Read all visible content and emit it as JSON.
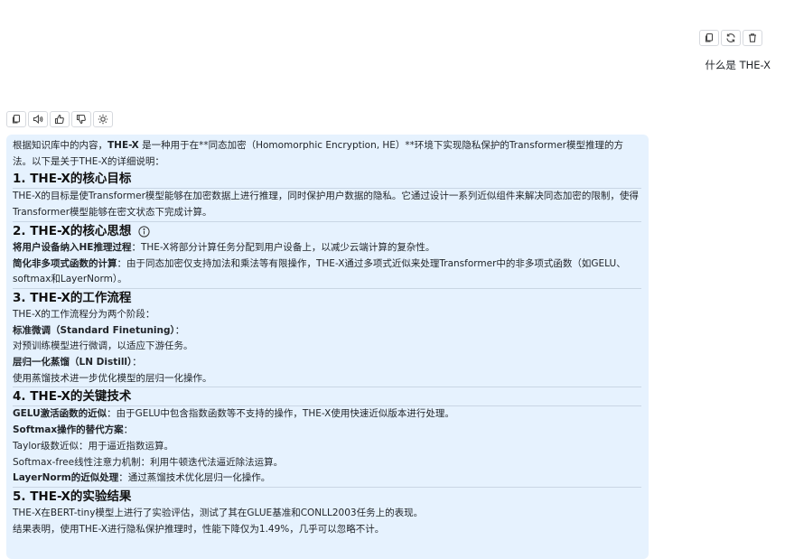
{
  "user_message": "什么是 THE-X",
  "user_toolbar": {
    "icons": [
      "copy-icon",
      "refresh-icon",
      "trash-icon"
    ]
  },
  "ai_toolbar": {
    "icons": [
      "copy-icon",
      "speaker-icon",
      "thumbs-up-icon",
      "thumbs-down-icon",
      "sun-icon"
    ]
  },
  "answer": {
    "intro_1": "根据知识库中的内容，",
    "intro_bold": "THE-X",
    "intro_2": " 是一种用于在**同态加密（Homomorphic Encryption, HE）**环境下实现隐私保护的Transformer模型推理的方法。以下是关于THE-X的详细说明：",
    "s1_title": "1. THE-X的核心目标",
    "s1_text": "THE-X的目标是使Transformer模型能够在加密数据上进行推理，同时保护用户数据的隐私。它通过设计一系列近似组件来解决同态加密的限制，使得Transformer模型能够在密文状态下完成计算。",
    "s2_title": "2. THE-X的核心思想",
    "s2_item1_bold": "将用户设备纳入HE推理过程",
    "s2_item1_text": "：THE-X将部分计算任务分配到用户设备上，以减少云端计算的复杂性。",
    "s2_item2_bold": "简化非多项式函数的计算",
    "s2_item2_text": "：由于同态加密仅支持加法和乘法等有限操作，THE-X通过多项式近似来处理Transformer中的非多项式函数（如GELU、softmax和LayerNorm）。",
    "s3_title": "3. THE-X的工作流程",
    "s3_intro": "THE-X的工作流程分为两个阶段：",
    "s3_stage1_bold": "标准微调（Standard Finetuning）",
    "s3_stage1_colon": "：",
    "s3_stage1_text": "对预训练模型进行微调，以适应下游任务。",
    "s3_stage2_bold": "层归一化蒸馏（LN Distill）",
    "s3_stage2_colon": "：",
    "s3_stage2_text": "使用蒸馏技术进一步优化模型的层归一化操作。",
    "s4_title": "4. THE-X的关键技术",
    "s4_item1_bold": "GELU激活函数的近似",
    "s4_item1_text": "：由于GELU中包含指数函数等不支持的操作，THE-X使用快速近似版本进行处理。",
    "s4_item2_bold": "Softmax操作的替代方案",
    "s4_item2_colon": "：",
    "s4_item2_sub1": "Taylor级数近似：用于逼近指数运算。",
    "s4_item2_sub2": "Softmax-free线性注意力机制：利用牛顿迭代法逼近除法运算。",
    "s4_item3_bold": "LayerNorm的近似处理",
    "s4_item3_text": "：通过蒸馏技术优化层归一化操作。",
    "s5_title": "5. THE-X的实验结果",
    "s5_text1": "THE-X在BERT-tiny模型上进行了实验评估，测试了其在GLUE基准和CONLL2003任务上的表现。",
    "s5_text2": "结果表明，使用THE-X进行隐私保护推理时，性能下降仅为1.49%，几乎可以忽略不计。"
  }
}
